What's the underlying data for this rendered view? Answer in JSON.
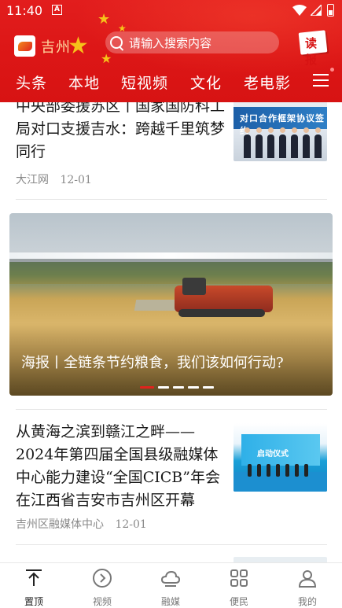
{
  "status_bar": {
    "time": "11:40",
    "notification": "A"
  },
  "header": {
    "logo_text": "吉州",
    "search_placeholder": "请输入搜索内容",
    "read_button": "读报",
    "tabs": [
      "头条",
      "本地",
      "短视频",
      "文化",
      "老电影"
    ]
  },
  "feed": {
    "articles": [
      {
        "title": "中央部委援苏区丨国家国防科工局对口支援吉水：跨越千里筑梦同行",
        "source": "大江网",
        "date": "12-01",
        "thumb_text": "对口合作框架协议签约"
      },
      {
        "title": "从黄海之滨到赣江之畔——2024年第四届全国县级融媒体中心能力建设“全国CICB”年会在江西省吉安市吉州区开幕",
        "source": "吉州区融媒体中心",
        "date": "12-01",
        "thumb_text": "启动仪式"
      }
    ],
    "hero": {
      "caption": "海报丨全链条节约粮食，我们该如何行动?",
      "slide_count": 5,
      "active_slide": 1
    }
  },
  "bottom_nav": [
    {
      "label": "置顶",
      "icon": "top-arrow-icon",
      "active": true
    },
    {
      "label": "视频",
      "icon": "play-circle-icon",
      "active": false
    },
    {
      "label": "融媒",
      "icon": "cloud-icon",
      "active": false
    },
    {
      "label": "便民",
      "icon": "grid-icon",
      "active": false
    },
    {
      "label": "我的",
      "icon": "user-icon",
      "active": false
    }
  ],
  "colors": {
    "brand_red": "#d71313",
    "accent_gold": "#f6c21a"
  }
}
